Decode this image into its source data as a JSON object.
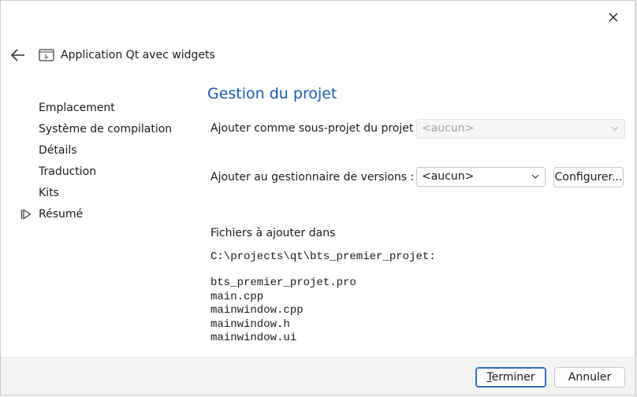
{
  "window": {
    "title": "Application Qt avec widgets",
    "close_icon": "close-icon",
    "back_icon": "back-arrow-icon",
    "app_icon": "application-window-icon"
  },
  "sidebar": {
    "items": [
      {
        "label": "Emplacement",
        "current": false
      },
      {
        "label": "Système de compilation",
        "current": false
      },
      {
        "label": "Détails",
        "current": false
      },
      {
        "label": "Traduction",
        "current": false
      },
      {
        "label": "Kits",
        "current": false
      },
      {
        "label": "Résumé",
        "current": true
      }
    ]
  },
  "page": {
    "title": "Gestion du projet",
    "subproject_label": "Ajouter comme sous-projet du projet :",
    "subproject_value": "<aucun>",
    "vcs_label": "Ajouter au gestionnaire de versions :",
    "vcs_value": "<aucun>",
    "configure_label": "Configurer...",
    "files_label": "Fichiers à ajouter dans",
    "files_path": "C:\\projects\\qt\\bts_premier_projet:",
    "files": [
      "bts_premier_projet.pro",
      "main.cpp",
      "mainwindow.cpp",
      "mainwindow.h",
      "mainwindow.ui"
    ]
  },
  "footer": {
    "finish_label": "Terminer",
    "cancel_label": "Annuler"
  },
  "colors": {
    "title_blue": "#1d5bb5",
    "primary_border": "#2f6fc0"
  }
}
